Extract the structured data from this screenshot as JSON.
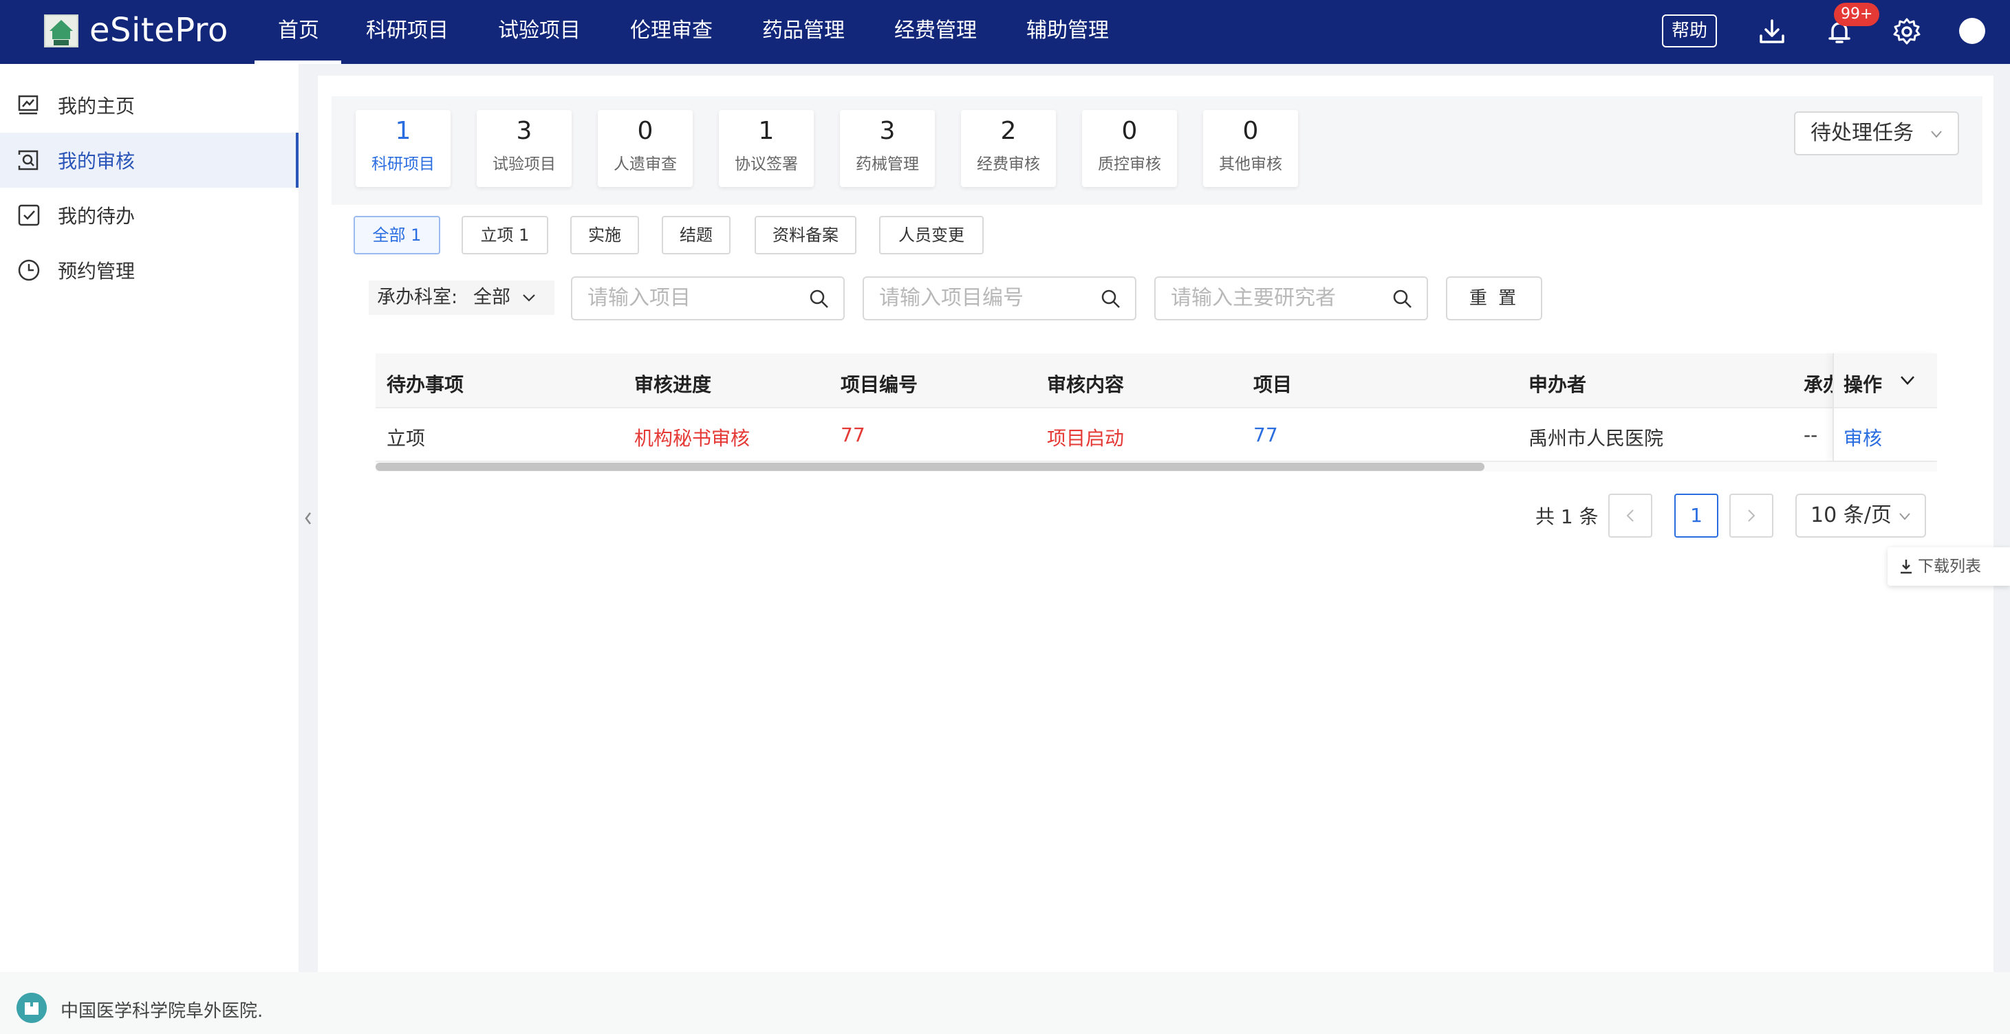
{
  "app": {
    "title": "eSitePro"
  },
  "topnav": {
    "items": [
      "首页",
      "科研项目",
      "试验项目",
      "伦理审查",
      "药品管理",
      "经费管理",
      "辅助管理"
    ],
    "active_index": 0
  },
  "header": {
    "help_label": "帮助",
    "notification_badge": "99+"
  },
  "sidebar": {
    "items": [
      {
        "label": "我的主页",
        "icon": "dashboard-icon"
      },
      {
        "label": "我的审核",
        "icon": "review-icon"
      },
      {
        "label": "我的待办",
        "icon": "checkbox-icon"
      },
      {
        "label": "预约管理",
        "icon": "clock-icon"
      }
    ],
    "active_index": 1
  },
  "stats": [
    {
      "num": "1",
      "label": "科研项目"
    },
    {
      "num": "3",
      "label": "试验项目"
    },
    {
      "num": "0",
      "label": "人遗审查"
    },
    {
      "num": "1",
      "label": "协议签署"
    },
    {
      "num": "3",
      "label": "药械管理"
    },
    {
      "num": "2",
      "label": "经费审核"
    },
    {
      "num": "0",
      "label": "质控审核"
    },
    {
      "num": "0",
      "label": "其他审核"
    }
  ],
  "task_dropdown": {
    "value": "待处理任务"
  },
  "filter_tabs": [
    "全部 1",
    "立项 1",
    "实施",
    "结题",
    "资料备案",
    "人员变更"
  ],
  "search": {
    "dept_label": "承办科室:",
    "dept_value": "全部",
    "project_placeholder": "请输入项目",
    "code_placeholder": "请输入项目编号",
    "investigator_placeholder": "请输入主要研究者",
    "reset_label": "重 置"
  },
  "table": {
    "columns": [
      "待办事项",
      "审核进度",
      "项目编号",
      "审核内容",
      "项目",
      "申办者",
      "承办",
      "操作"
    ],
    "rows": [
      {
        "todo": "立项",
        "progress": "机构秘书审核",
        "code": "77",
        "content": "项目启动",
        "project": "77",
        "sponsor": "禹州市人民医院",
        "dept": "--",
        "action": "审核"
      }
    ]
  },
  "pagination": {
    "total_text": "共 1 条",
    "current_page": "1",
    "page_size": "10 条/页"
  },
  "download_list_label": "下载列表",
  "footer": {
    "org_name": "中国医学科学院阜外医院."
  },
  "colors": {
    "topbar": "#12277a",
    "accent": "#2a6de0",
    "danger": "#e53935"
  }
}
